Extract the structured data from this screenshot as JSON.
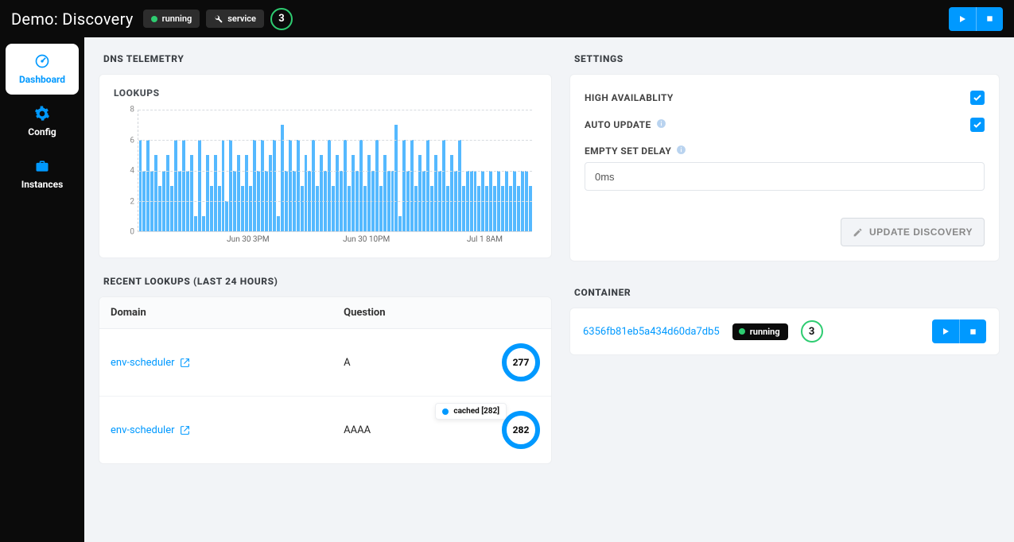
{
  "header": {
    "title": "Demo: Discovery",
    "status_label": "running",
    "type_label": "service",
    "count": "3"
  },
  "nav": {
    "items": [
      {
        "label": "Dashboard",
        "icon": "gauge"
      },
      {
        "label": "Config",
        "icon": "gear"
      },
      {
        "label": "Instances",
        "icon": "briefcase"
      }
    ]
  },
  "telemetry": {
    "title": "DNS TELEMETRY",
    "chart_title": "LOOKUPS"
  },
  "chart_data": {
    "type": "bar",
    "ylabel": "",
    "ylim": [
      0,
      8
    ],
    "y_ticks": [
      0,
      2,
      4,
      6,
      8
    ],
    "x_ticks": [
      {
        "pos": 0.28,
        "label": "Jun 30 3PM"
      },
      {
        "pos": 0.58,
        "label": "Jun 30 10PM"
      },
      {
        "pos": 0.88,
        "label": "Jul 1 8AM"
      }
    ],
    "values": [
      6,
      4,
      6,
      4,
      5,
      3,
      4,
      5,
      3,
      6,
      4,
      6,
      4,
      5,
      1,
      6,
      1,
      5,
      3,
      5,
      3,
      6,
      2,
      6,
      4,
      5,
      3,
      5,
      3,
      6,
      4,
      6,
      4,
      5,
      6,
      1,
      7,
      4,
      6,
      4,
      6,
      3,
      5,
      4,
      6,
      3,
      5,
      4,
      6,
      3,
      5,
      4,
      6,
      3,
      5,
      4,
      6,
      3,
      5,
      4,
      6,
      3,
      5,
      4,
      4,
      7,
      1,
      6,
      4,
      6,
      3,
      5,
      4,
      6,
      3,
      5,
      4,
      6,
      3,
      5,
      4,
      6,
      3,
      4,
      4,
      4,
      3,
      4,
      3,
      4,
      3,
      4,
      3,
      4,
      3,
      4,
      3,
      4,
      4,
      3
    ]
  },
  "recent": {
    "title": "RECENT LOOKUPS (LAST 24 HOURS)",
    "columns": {
      "domain": "Domain",
      "question": "Question"
    },
    "rows": [
      {
        "domain": "env-scheduler",
        "question": "A",
        "count": "277"
      },
      {
        "domain": "env-scheduler",
        "question": "AAAA",
        "count": "282",
        "cached_label": "cached [282]"
      }
    ]
  },
  "settings": {
    "title": "SETTINGS",
    "ha_label": "HIGH AVAILABLITY",
    "auto_update_label": "AUTO UPDATE",
    "empty_delay_label": "EMPTY SET DELAY",
    "empty_delay_value": "0ms",
    "update_button": "UPDATE DISCOVERY"
  },
  "container": {
    "title": "CONTAINER",
    "hash": "6356fb81eb5a434d60da7db5",
    "status": "running",
    "count": "3"
  }
}
